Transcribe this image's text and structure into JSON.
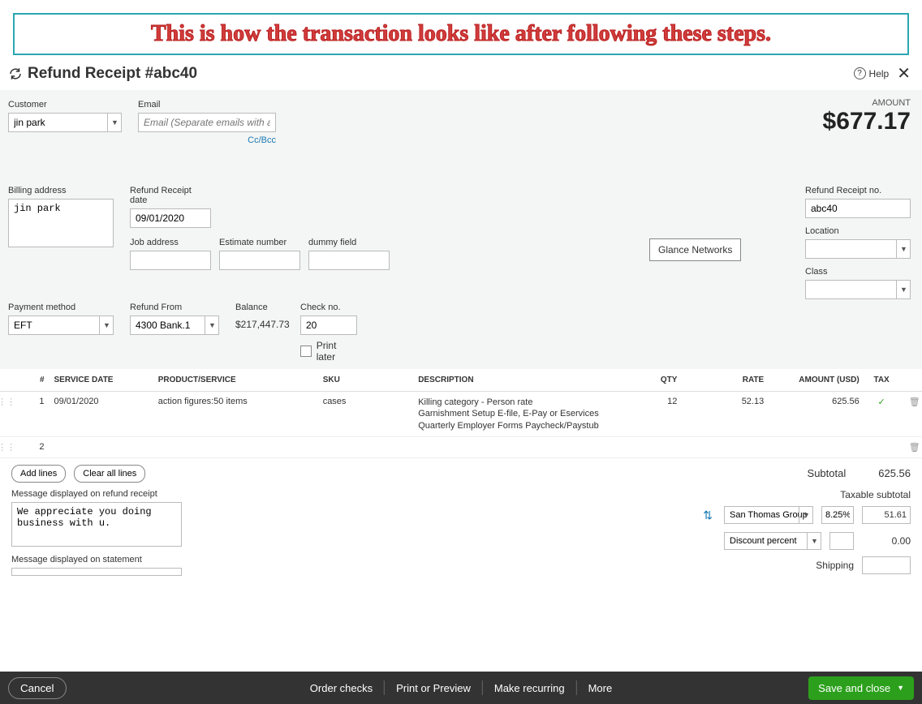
{
  "banner": "This is how the transaction looks like after following these steps.",
  "header": {
    "title": "Refund Receipt #abc40",
    "help": "Help"
  },
  "customer": {
    "label": "Customer",
    "value": "jin park"
  },
  "email": {
    "label": "Email",
    "placeholder": "Email (Separate emails with a comma)",
    "ccbcc": "Cc/Bcc"
  },
  "amount": {
    "label": "AMOUNT",
    "value": "$677.17"
  },
  "billing": {
    "label": "Billing address",
    "value": "jin park"
  },
  "receipt_date": {
    "label": "Refund Receipt date",
    "value": "09/01/2020"
  },
  "job_address": {
    "label": "Job address",
    "value": ""
  },
  "estimate_no": {
    "label": "Estimate number",
    "value": ""
  },
  "dummy": {
    "label": "dummy field",
    "value": ""
  },
  "glance": "Glance Networks",
  "receipt_no": {
    "label": "Refund Receipt no.",
    "value": "abc40"
  },
  "location": {
    "label": "Location",
    "value": ""
  },
  "class": {
    "label": "Class",
    "value": ""
  },
  "payment_method": {
    "label": "Payment method",
    "value": "EFT"
  },
  "refund_from": {
    "label": "Refund From",
    "value": "4300 Bank.1"
  },
  "balance": {
    "label": "Balance",
    "value": "$217,447.73"
  },
  "check_no": {
    "label": "Check no.",
    "value": "20",
    "print_later": "Print later"
  },
  "table": {
    "headers": {
      "num": "#",
      "service_date": "SERVICE DATE",
      "product": "PRODUCT/SERVICE",
      "sku": "SKU",
      "desc": "DESCRIPTION",
      "qty": "QTY",
      "rate": "RATE",
      "amount": "AMOUNT (USD)",
      "tax": "TAX"
    },
    "rows": [
      {
        "num": "1",
        "service_date": "09/01/2020",
        "product": "action figures:50 items",
        "sku": "cases",
        "desc": "Killing category - Person rate\nGarnishment Setup E-file, E-Pay or Eservices\nQuarterly Employer Forms Paycheck/Paystub",
        "qty": "12",
        "rate": "52.13",
        "amount": "625.56",
        "tax": "✓"
      },
      {
        "num": "2",
        "service_date": "",
        "product": "",
        "sku": "",
        "desc": "",
        "qty": "",
        "rate": "",
        "amount": "",
        "tax": ""
      }
    ]
  },
  "buttons": {
    "add_lines": "Add lines",
    "clear_lines": "Clear all lines"
  },
  "subtotal": {
    "label": "Subtotal",
    "value": "625.56"
  },
  "message_receipt": {
    "label": "Message displayed on refund receipt",
    "value": "We appreciate you doing business with u."
  },
  "message_statement": {
    "label": "Message displayed on statement",
    "value": ""
  },
  "taxable_subtotal": {
    "label": "Taxable subtotal"
  },
  "tax_group": {
    "value": "San Thomas Group",
    "percent": "8.25%",
    "amount": "51.61"
  },
  "discount": {
    "label": "Discount percent",
    "value": "",
    "amount": "0.00"
  },
  "shipping": {
    "label": "Shipping"
  },
  "footer": {
    "cancel": "Cancel",
    "order_checks": "Order checks",
    "print": "Print or Preview",
    "recurring": "Make recurring",
    "more": "More",
    "save": "Save and close"
  }
}
